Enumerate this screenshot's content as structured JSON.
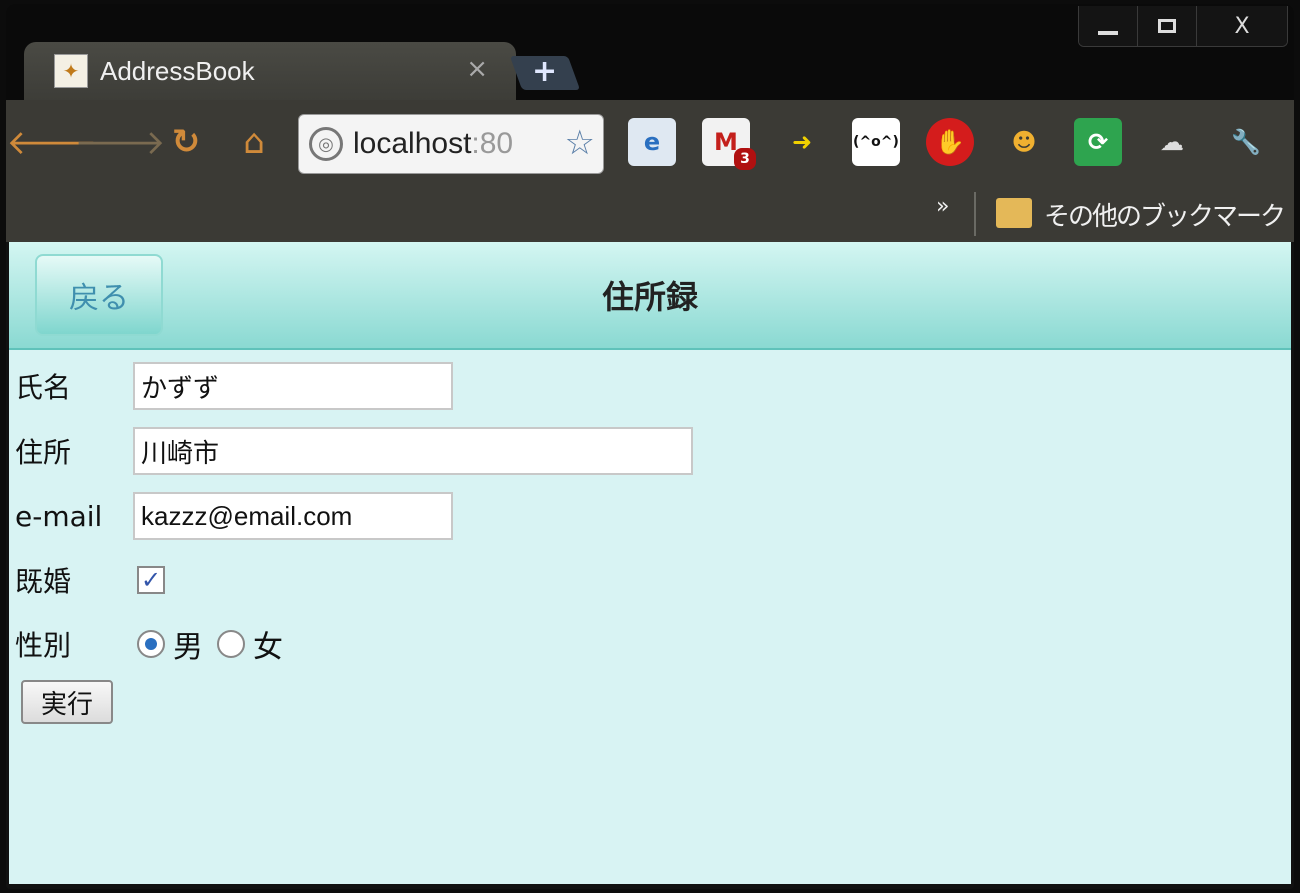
{
  "browser": {
    "tab_title": "AddressBook",
    "tab_close": "×",
    "new_tab": "+",
    "url_host": "localhost",
    "url_port": ":80",
    "mail_badge": "3",
    "emoticon_ext": "(^o^)",
    "bookmarks_chevron": "»",
    "other_bookmarks": "その他のブックマーク",
    "window_close": "X"
  },
  "page": {
    "back_label": "戻る",
    "title": "住所録",
    "fields": {
      "name_label": "氏名",
      "name_value": "かずず",
      "address_label": "住所",
      "address_value": "川崎市",
      "email_label": "e-mail",
      "email_value": "kazzz@email.com",
      "married_label": "既婚",
      "married_checked": true,
      "gender_label": "性別",
      "gender_male": "男",
      "gender_female": "女",
      "gender_selected": "男"
    },
    "submit_label": "実行"
  },
  "colors": {
    "header_top": "#d4f6f2",
    "header_bottom": "#8ad9d2",
    "page_bg": "#d8f3f3",
    "back_text": "#3f8fae"
  }
}
